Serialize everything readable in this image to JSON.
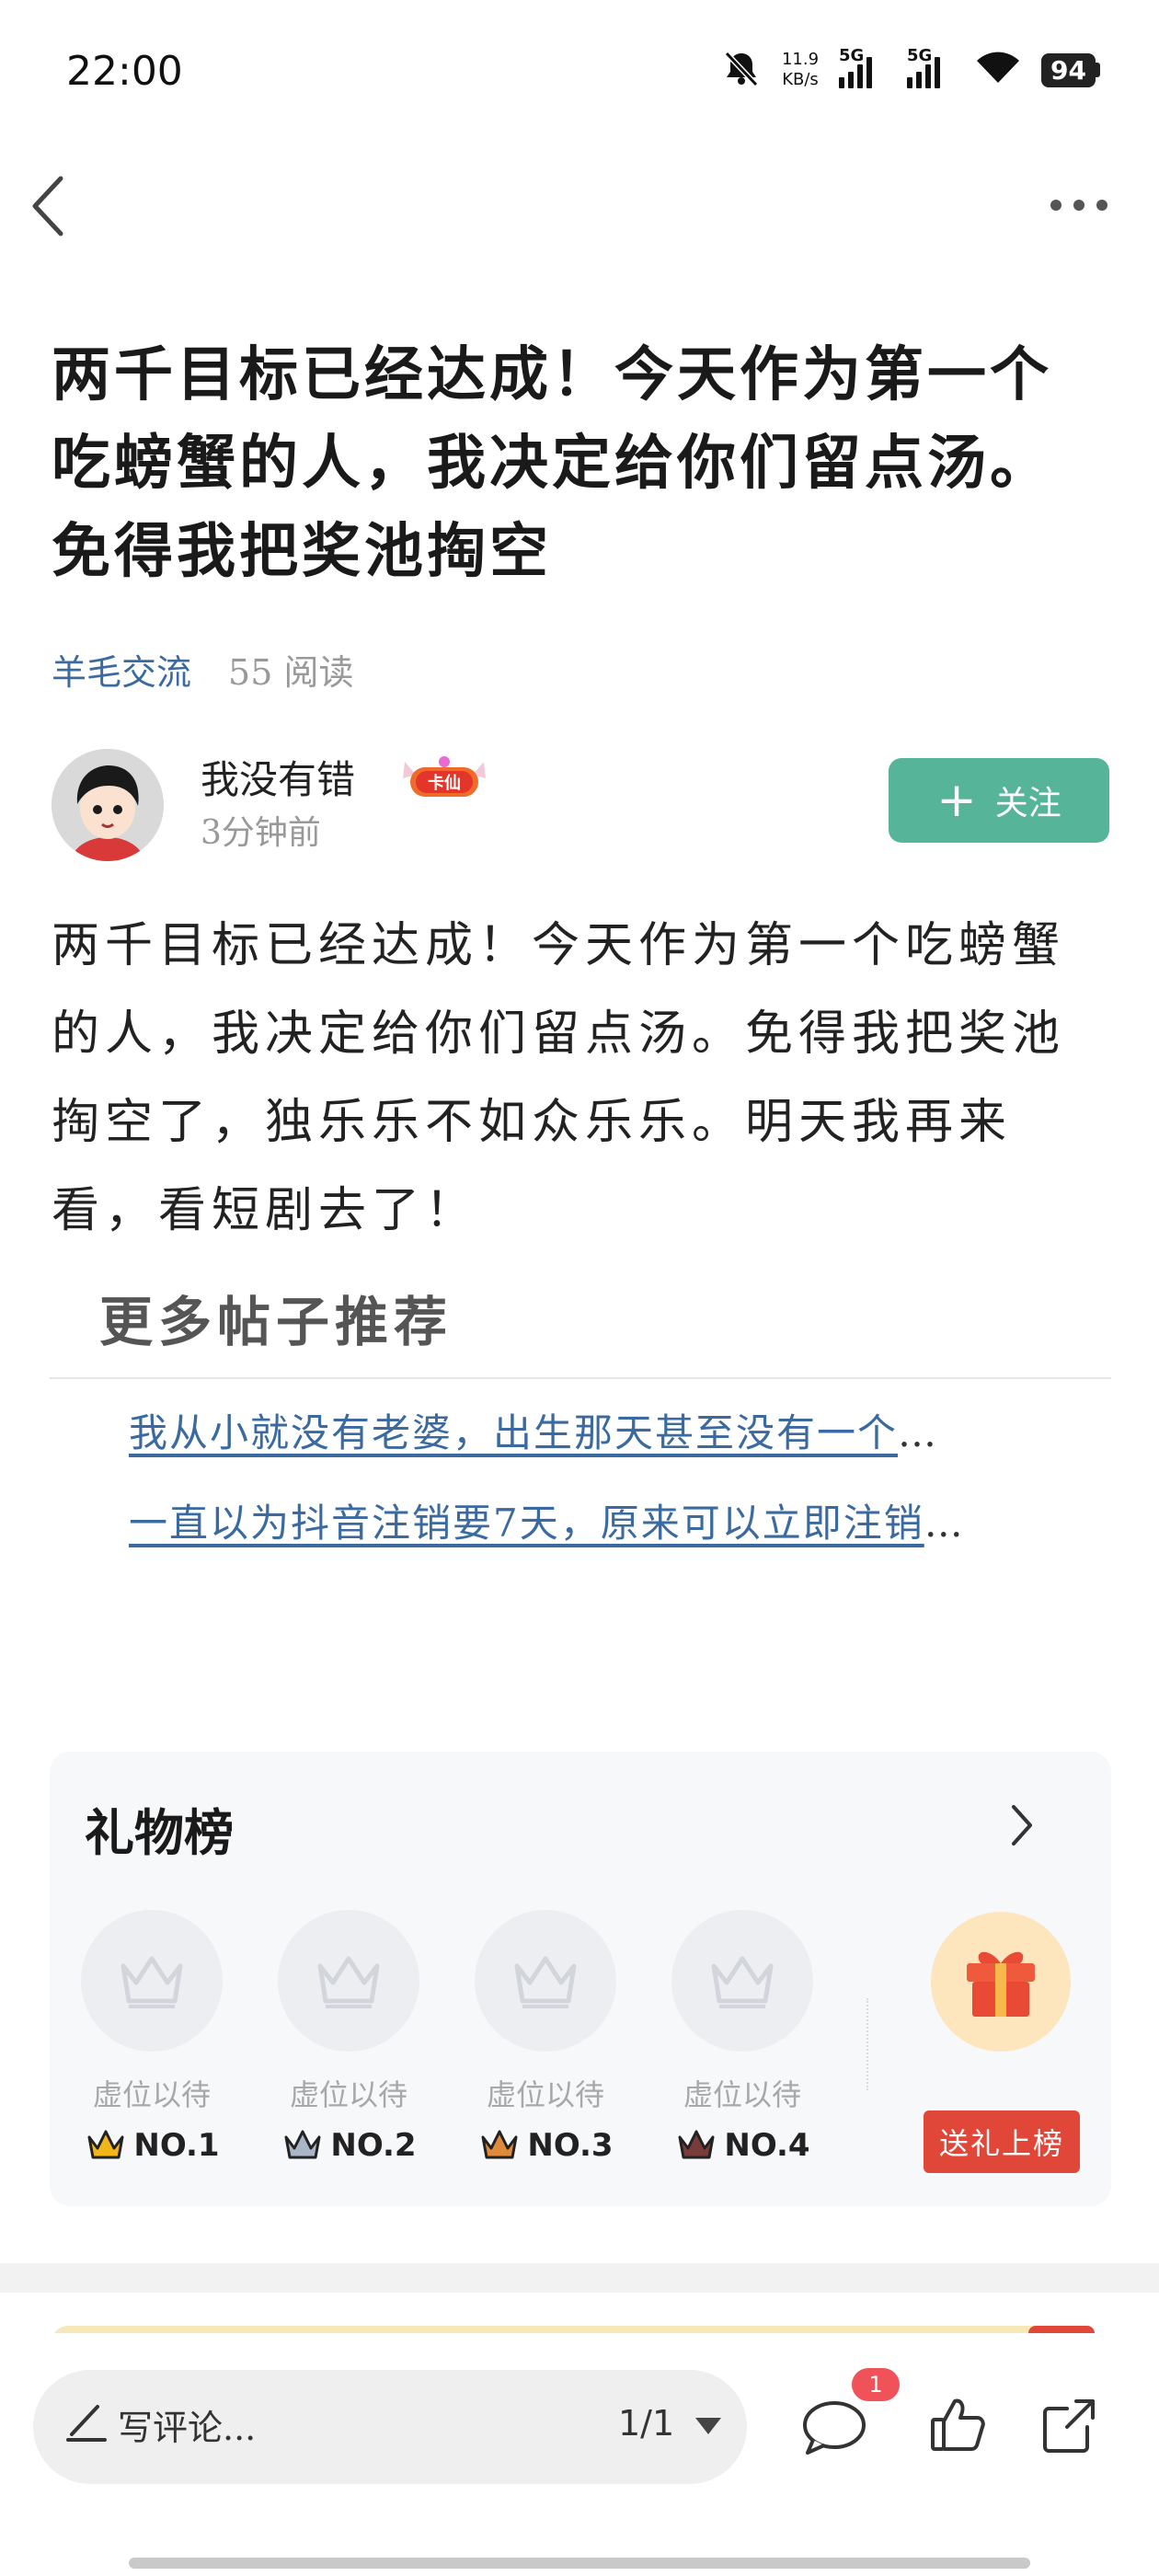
{
  "status_bar": {
    "time": "22:00",
    "net_speed": "11.9",
    "net_unit": "KB/s",
    "sim1": "5G",
    "sim2": "5G",
    "battery": "94",
    "icons": [
      "mute-bell-icon",
      "signal-icon",
      "signal-icon",
      "wifi-icon",
      "battery-icon"
    ]
  },
  "nav": {
    "icons": [
      "back-chevron-icon",
      "more-dots-icon"
    ]
  },
  "post": {
    "title": "两千目标已经达成！今天作为第一个吃螃蟹的人，我决定给你们留点汤。免得我把奖池掏空",
    "category": "羊毛交流",
    "reads": "55 阅读",
    "author": "我没有错",
    "badge_text": "卡仙",
    "time_ago": "3分钟前",
    "follow_label": "关注",
    "body": "两千目标已经达成！今天作为第一个吃螃蟹的人，我决定给你们留点汤。免得我把奖池掏空了，独乐乐不如众乐乐。明天我再来看，看短剧去了！"
  },
  "recommend": {
    "title": "更多帖子推荐",
    "items": [
      {
        "text": "我从小就没有老婆，出生那天甚至没有一个",
        "ellipsis": "…"
      },
      {
        "text": "一直以为抖音注销要7天，原来可以立即注销",
        "ellipsis": "…"
      }
    ]
  },
  "gift": {
    "title": "礼物榜",
    "slots": [
      {
        "placeholder": "虚位以待",
        "rank": "NO.1",
        "crown_color": "#f2b61b"
      },
      {
        "placeholder": "虚位以待",
        "rank": "NO.2",
        "crown_color": "#a9b6c8"
      },
      {
        "placeholder": "虚位以待",
        "rank": "NO.3",
        "crown_color": "#e08b3c"
      },
      {
        "placeholder": "虚位以待",
        "rank": "NO.4",
        "crown_color": "#7a3b3b"
      }
    ],
    "send_label": "送礼上榜",
    "accent": "#e14738"
  },
  "bottom": {
    "comment_placeholder": "写评论...",
    "page": "1/1",
    "comment_count": "1"
  },
  "colors": {
    "follow": "#56b598",
    "link": "#3b6aa0",
    "badge": "#f0525a"
  }
}
